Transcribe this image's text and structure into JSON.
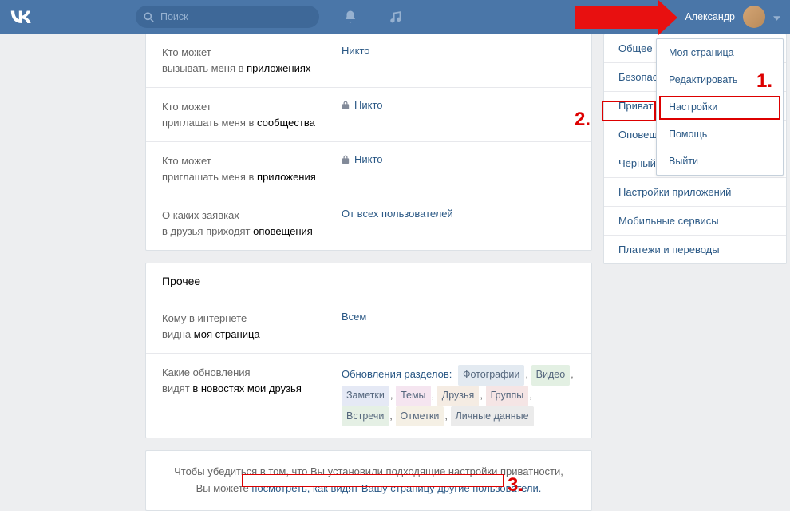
{
  "header": {
    "search_placeholder": "Поиск",
    "username": "Александр"
  },
  "dropdown": {
    "my_page": "Моя страница",
    "edit": "Редактировать",
    "settings": "Настройки",
    "help": "Помощь",
    "logout": "Выйти"
  },
  "settings": {
    "row1": {
      "label_line1": "Кто может",
      "label_line2_pre": "вызывать меня в ",
      "label_line2_bold": "приложениях",
      "value": "Никто"
    },
    "row2": {
      "label_line1": "Кто может",
      "label_line2_pre": "приглашать меня в ",
      "label_line2_bold": "сообщества",
      "value": "Никто"
    },
    "row3": {
      "label_line1": "Кто может",
      "label_line2_pre": "приглашать меня в ",
      "label_line2_bold": "приложения",
      "value": "Никто"
    },
    "row4": {
      "label_line1": "О каких заявках",
      "label_line2_pre": "в друзья приходят ",
      "label_line2_bold": "оповещения",
      "value": "От всех пользователей"
    }
  },
  "other_section": {
    "title": "Прочее",
    "row1": {
      "label_line1": "Кому в интернете",
      "label_line2_pre": "видна ",
      "label_line2_bold": "моя страница",
      "value": "Всем"
    },
    "row2": {
      "label_line1": "Какие обновления",
      "label_line2_pre": "видят ",
      "label_line2_bold": "в новостях мои друзья",
      "updates_label": "Обновления разделов: ",
      "tags": {
        "photo": "Фотографии",
        "video": "Видео",
        "notes": "Заметки",
        "themes": "Темы",
        "friends": "Друзья",
        "groups": "Группы",
        "events": "Встречи",
        "marks": "Отметки",
        "personal": "Личные данные"
      }
    }
  },
  "footer": {
    "line1": "Чтобы убедиться в том, что Вы установили подходящие настройки приватности,",
    "line2_pre": "Вы можете ",
    "line2_link": "посмотреть, как видят Вашу страницу другие пользователи."
  },
  "sidebar": {
    "general": "Общее",
    "security": "Безопасность",
    "privacy": "Приватность",
    "notifications": "Оповещения",
    "blacklist": "Чёрный список",
    "app_settings": "Настройки приложений",
    "mobile": "Мобильные сервисы",
    "payments": "Платежи и переводы"
  },
  "annotations": {
    "n1": "1.",
    "n2": "2.",
    "n3": "3."
  }
}
